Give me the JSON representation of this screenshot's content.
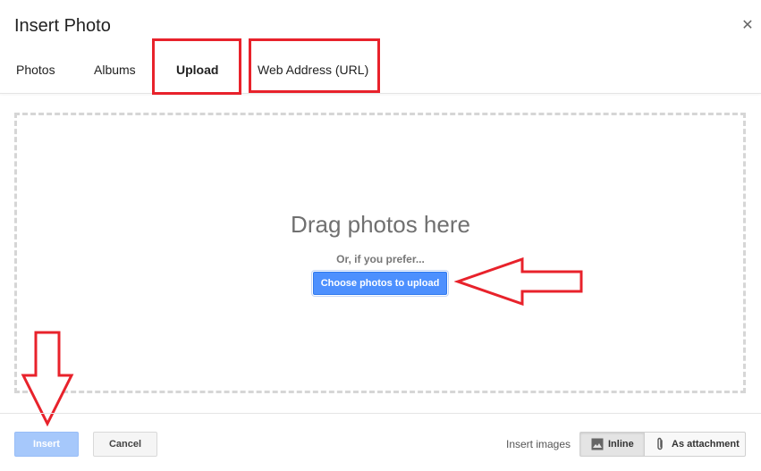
{
  "dialog": {
    "title": "Insert Photo",
    "close_icon": "close-icon"
  },
  "tabs": [
    {
      "label": "Photos",
      "active": false
    },
    {
      "label": "Albums",
      "active": false
    },
    {
      "label": "Upload",
      "active": true
    },
    {
      "label": "Web Address (URL)",
      "active": false
    }
  ],
  "upload": {
    "drag_text": "Drag photos here",
    "or_text": "Or, if you prefer...",
    "choose_button": "Choose photos to upload"
  },
  "footer": {
    "insert_label": "Insert",
    "cancel_label": "Cancel",
    "insert_images_label": "Insert images",
    "inline_label": "Inline",
    "attachment_label": "As attachment",
    "inline_icon": "image-icon",
    "attachment_icon": "paperclip-icon"
  },
  "colors": {
    "accent": "#4d90fe",
    "annotation": "#e8222b"
  }
}
